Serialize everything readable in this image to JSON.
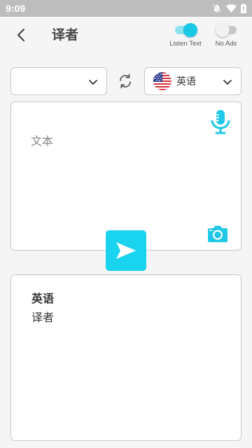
{
  "status_bar": {
    "time": "9:09"
  },
  "header": {
    "title": "译者",
    "back_icon": "chevron-left-icon"
  },
  "toggles": {
    "listen_text": {
      "label": "Listen Text",
      "on": true
    },
    "no_ads": {
      "label": "No Ads",
      "on": false
    }
  },
  "languages": {
    "source": {
      "label": ""
    },
    "target": {
      "label": "英语",
      "flag_icon": "us-flag-icon"
    }
  },
  "input": {
    "placeholder": "文本"
  },
  "output": {
    "language": "英语",
    "text": "译者"
  },
  "colors": {
    "accent": "#1ad3ee",
    "mic": "#1ec8e6",
    "status_bar": "#bdbdbd"
  }
}
